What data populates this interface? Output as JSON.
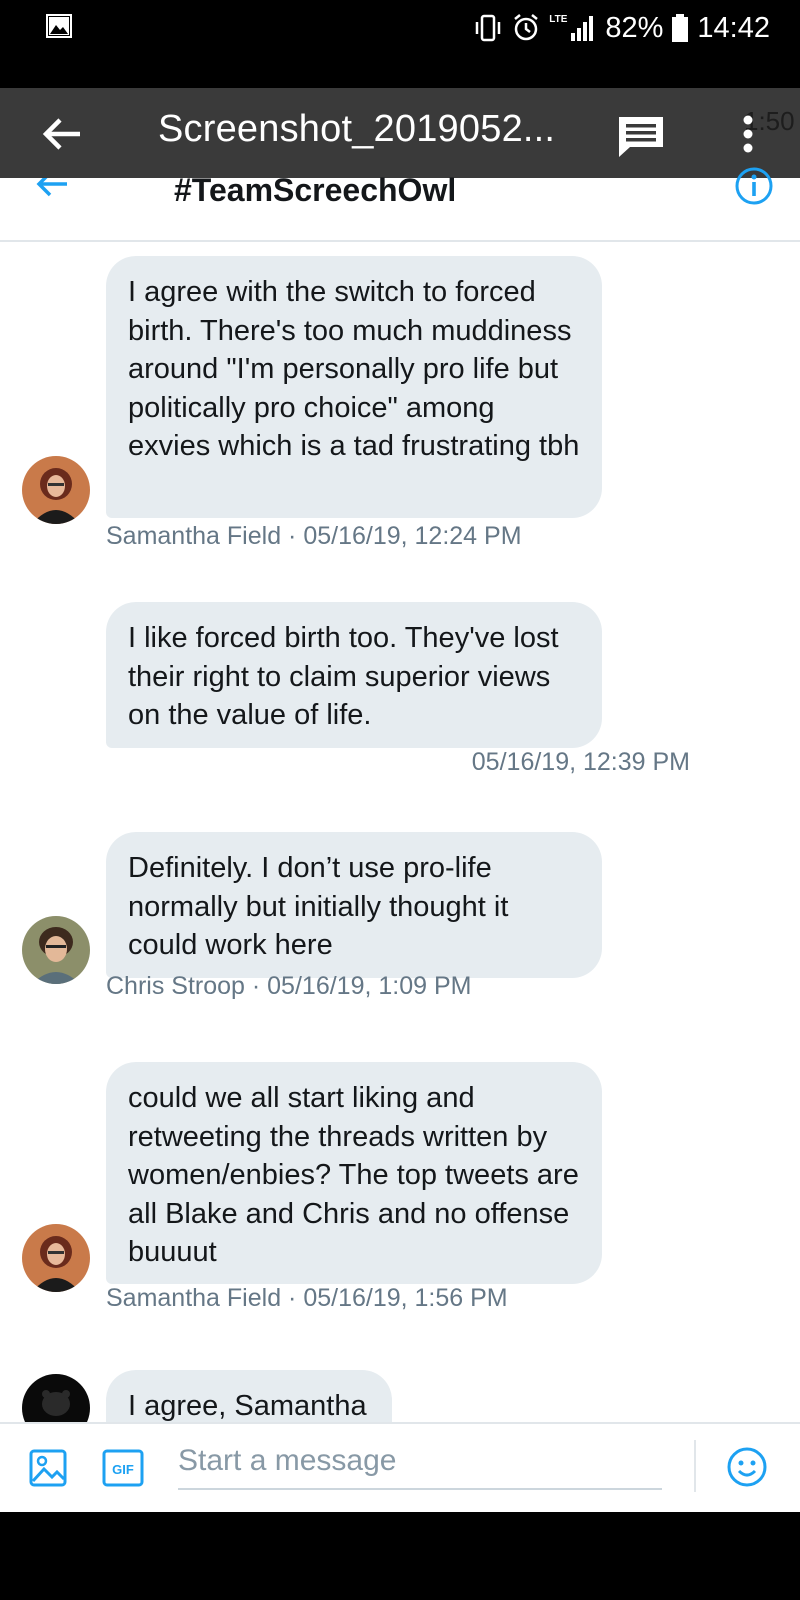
{
  "status_bar": {
    "network": "LTE",
    "battery": "82%",
    "time": "14:42",
    "icons": [
      "gallery-icon",
      "vibrate-icon",
      "alarm-icon",
      "signal-icon",
      "battery-icon"
    ]
  },
  "viewer": {
    "file_title": "Screenshot_2019052...",
    "ghost_time": "1:50",
    "icons": [
      "back-arrow-icon",
      "comment-icon",
      "more-vert-icon"
    ]
  },
  "conversation": {
    "title": "#TeamScreechOwl",
    "accent_color": "#1da1f2",
    "bubble_color": "#e6ecf0",
    "messages": [
      {
        "text": "I agree with the switch to forced birth. There's too much muddiness around \"I'm personally pro life but politically pro choice\" among exvies which is a tad frustrating tbh",
        "meta": "Samantha Field · 05/16/19, 12:24 PM"
      },
      {
        "text": "I like forced birth too. They've lost their right to claim superior views on the value of life.",
        "meta": "05/16/19, 12:39 PM"
      },
      {
        "text": "Definitely. I don’t use pro-life normally but initially thought it could work here",
        "meta": "Chris Stroop · 05/16/19, 1:09 PM"
      },
      {
        "text": "could we all start liking and retweeting the threads written by women/enbies? The top tweets are all Blake and Chris and no offense buuuut",
        "meta": "Samantha Field · 05/16/19, 1:56 PM"
      },
      {
        "text": "I agree, Samantha",
        "meta": ""
      }
    ]
  },
  "composer": {
    "placeholder": "Start a message",
    "gif_label": "GIF",
    "icons": [
      "image-icon",
      "gif-icon",
      "emoji-icon"
    ]
  }
}
